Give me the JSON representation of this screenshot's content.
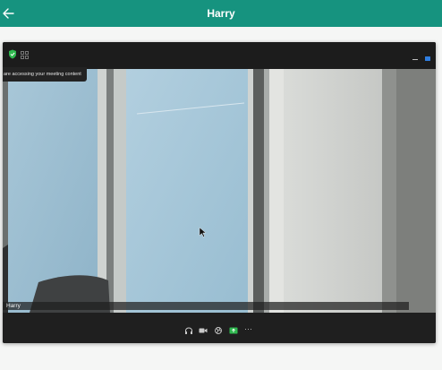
{
  "header": {
    "title": "Harry",
    "back_icon": "arrow-left-icon",
    "bg_color": "#16937f"
  },
  "meeting": {
    "notification_text": "are accessing your meeting content",
    "participant_name": "Harry",
    "titlebar_icons": [
      "shield-check-icon",
      "grid-view-icon",
      "minimize-icon",
      "restore-icon"
    ],
    "toolbar_icons": [
      "headset-icon",
      "camera-icon",
      "globe-icon",
      "share-screen-icon",
      "more-icon"
    ],
    "more_label": "···",
    "accent_green": "#2fb84f",
    "accent_blue": "#2f7ee0"
  }
}
